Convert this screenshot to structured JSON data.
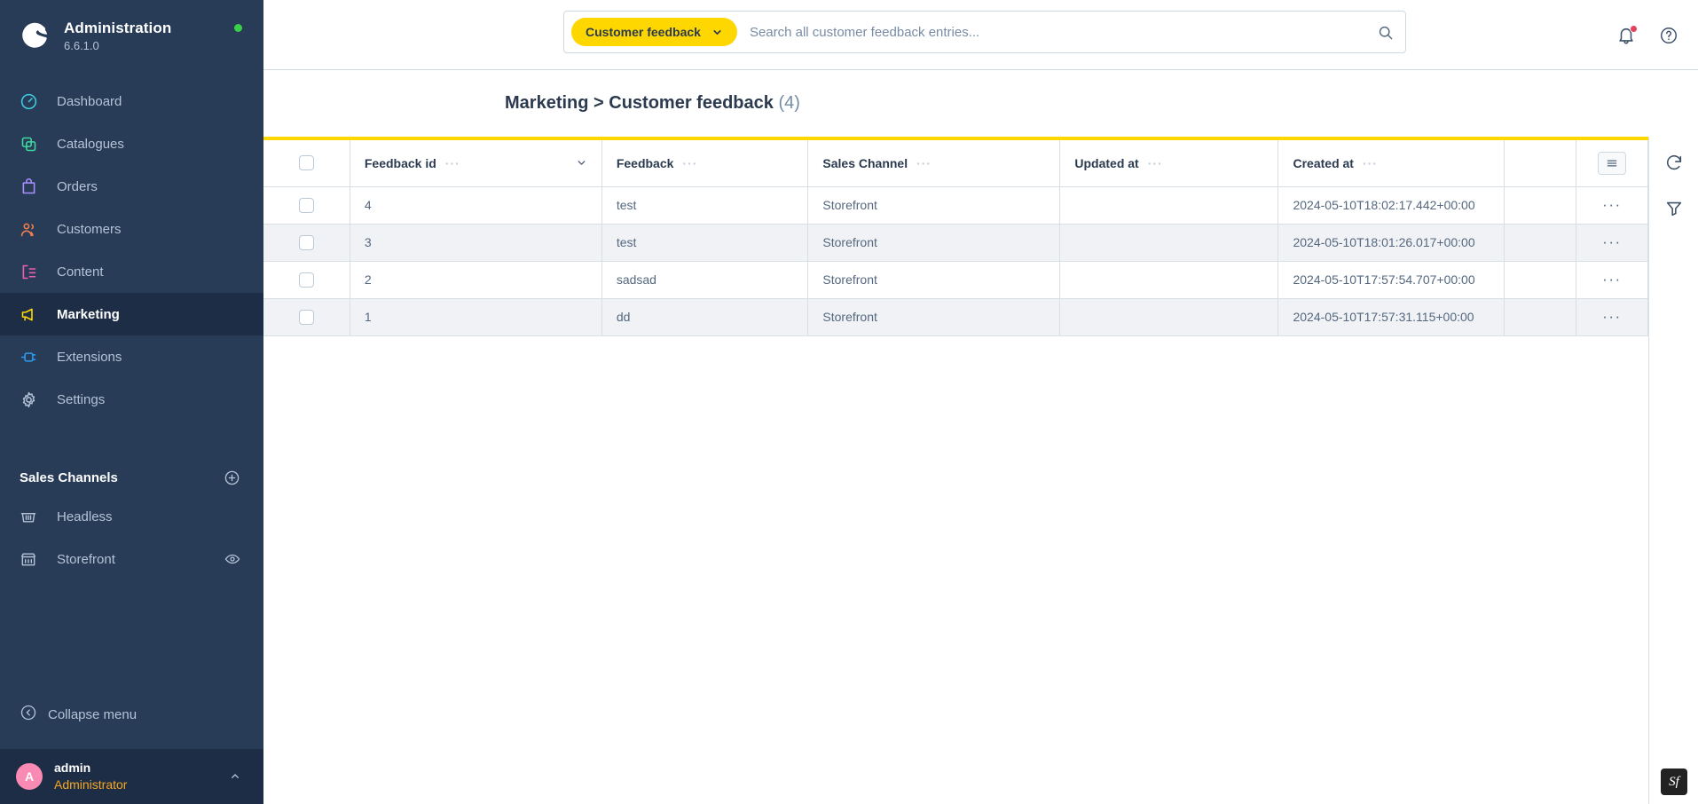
{
  "brand": {
    "title": "Administration",
    "version": "6.6.1.0",
    "status_dot_color": "#37d046",
    "logo_icon": "shopware-logo-icon"
  },
  "sidebar": {
    "items": [
      {
        "label": "Dashboard",
        "icon": "speedometer-icon",
        "color": "#3ecde0",
        "active": false
      },
      {
        "label": "Catalogues",
        "icon": "copy-stack-icon",
        "color": "#3fd9a0",
        "active": false
      },
      {
        "label": "Orders",
        "icon": "bag-icon",
        "color": "#a98eff",
        "active": false
      },
      {
        "label": "Customers",
        "icon": "users-icon",
        "color": "#f57f4f",
        "active": false
      },
      {
        "label": "Content",
        "icon": "content-list-icon",
        "color": "#f25eb0",
        "active": false
      },
      {
        "label": "Marketing",
        "icon": "megaphone-icon",
        "color": "#ffd700",
        "active": true
      },
      {
        "label": "Extensions",
        "icon": "plug-icon",
        "color": "#2e9bf0",
        "active": false
      },
      {
        "label": "Settings",
        "icon": "gear-icon",
        "color": "#b4c3d6",
        "active": false
      }
    ],
    "sales_channels": {
      "title": "Sales Channels",
      "add_icon": "plus-circle-icon",
      "items": [
        {
          "label": "Headless",
          "icon": "basket-icon",
          "trailing_icon": ""
        },
        {
          "label": "Storefront",
          "icon": "store-icon",
          "trailing_icon": "eye-icon"
        }
      ]
    },
    "collapse": {
      "label": "Collapse menu",
      "icon": "chevron-left-circle-icon"
    },
    "user": {
      "initial": "A",
      "name": "admin",
      "role": "Administrator",
      "avatar_color": "#f88ab3",
      "role_color": "#f5a623",
      "chevron_icon": "chevron-up-icon"
    }
  },
  "topbar": {
    "scope_label": "Customer feedback",
    "scope_chevron_icon": "chevron-down-icon",
    "search_placeholder": "Search all customer feedback entries...",
    "search_value": "",
    "search_icon": "magnifier-icon",
    "notifications_icon": "bell-icon",
    "notifications_has_badge": true,
    "help_icon": "question-circle-icon"
  },
  "page": {
    "breadcrumb": "Marketing > Customer feedback",
    "count": "(4)",
    "accent_color": "#ffd700"
  },
  "table": {
    "select_all_checked": false,
    "columns": [
      {
        "key": "feedback_id",
        "label": "Feedback id",
        "has_dots": true,
        "sortable": true
      },
      {
        "key": "feedback",
        "label": "Feedback",
        "has_dots": true,
        "sortable": false
      },
      {
        "key": "sales_channel",
        "label": "Sales Channel",
        "has_dots": true,
        "sortable": false
      },
      {
        "key": "updated_at",
        "label": "Updated at",
        "has_dots": true,
        "sortable": false
      },
      {
        "key": "created_at",
        "label": "Created at",
        "has_dots": true,
        "sortable": false
      }
    ],
    "settings_icon": "list-settings-icon",
    "row_action_icon": "ellipsis-icon",
    "rows": [
      {
        "feedback_id": "4",
        "feedback": "test",
        "sales_channel": "Storefront",
        "updated_at": "",
        "created_at": "2024-05-10T18:02:17.442+00:00"
      },
      {
        "feedback_id": "3",
        "feedback": "test",
        "sales_channel": "Storefront",
        "updated_at": "",
        "created_at": "2024-05-10T18:01:26.017+00:00"
      },
      {
        "feedback_id": "2",
        "feedback": "sadsad",
        "sales_channel": "Storefront",
        "updated_at": "",
        "created_at": "2024-05-10T17:57:54.707+00:00"
      },
      {
        "feedback_id": "1",
        "feedback": "dd",
        "sales_channel": "Storefront",
        "updated_at": "",
        "created_at": "2024-05-10T17:57:31.115+00:00"
      }
    ]
  },
  "right_rail": {
    "refresh_icon": "refresh-icon",
    "filter_icon": "filter-funnel-icon"
  },
  "debug_toolbar": {
    "label": "Sf",
    "icon": "symfony-profiler-icon"
  }
}
